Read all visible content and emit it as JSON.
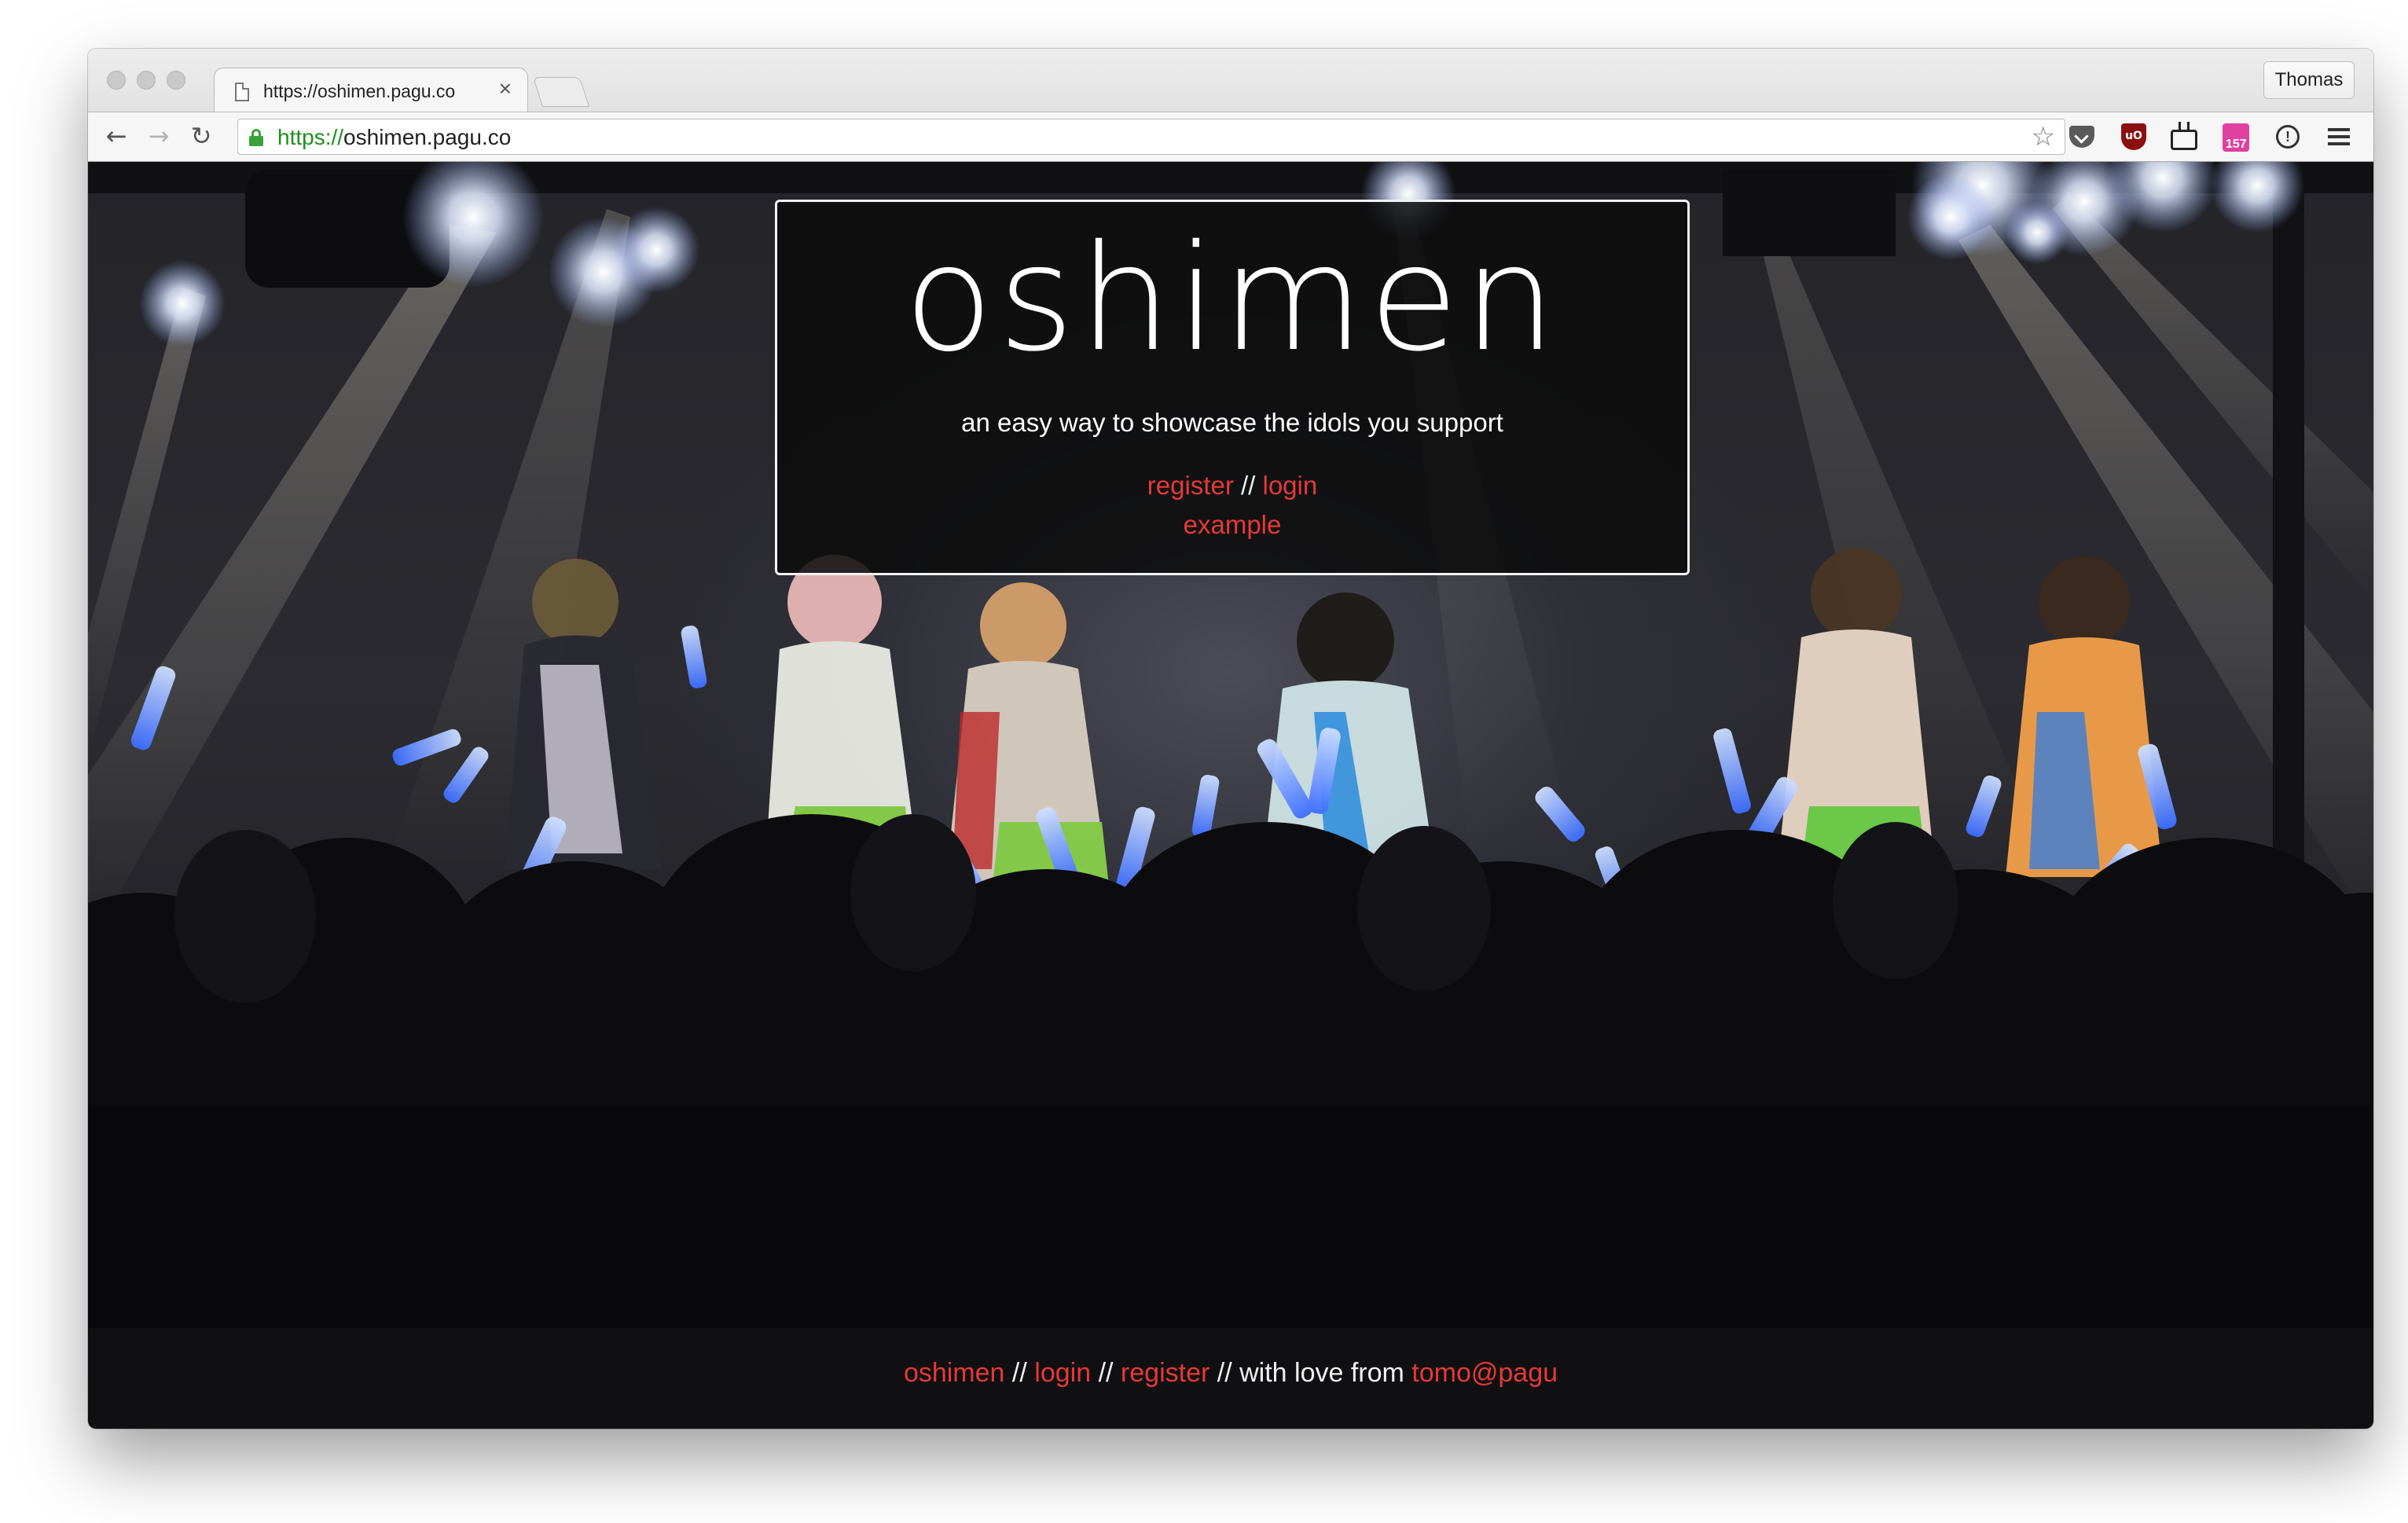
{
  "browser": {
    "tab_title": "https://oshimen.pagu.co",
    "tab_close": "×",
    "profile_name": "Thomas",
    "url_scheme": "https://",
    "url_host": "oshimen.pagu.co",
    "badge_count": "157",
    "ublock_label": "uO",
    "nav": {
      "back": "←",
      "forward": "→",
      "reload": "↻"
    },
    "bookmark": "☆",
    "icons": [
      "page-icon",
      "lock-icon",
      "star-icon",
      "pocket-icon",
      "ublock-icon",
      "tv-icon",
      "badge-icon",
      "info-icon",
      "menu-icon"
    ]
  },
  "hero": {
    "title": "oshimen",
    "tagline": "an easy way to showcase the idols you support",
    "register_label": "register",
    "separator": "//",
    "login_label": "login",
    "example_label": "example"
  },
  "footer": {
    "oshimen_label": "oshimen",
    "separator": "//",
    "login_label": "login",
    "register_label": "register",
    "with_love_text": "with love from",
    "credit_label": "tomo@pagu"
  },
  "colors": {
    "link": "#e53935",
    "footer_bg": "#101012",
    "card_border": "#f2f2f2"
  }
}
